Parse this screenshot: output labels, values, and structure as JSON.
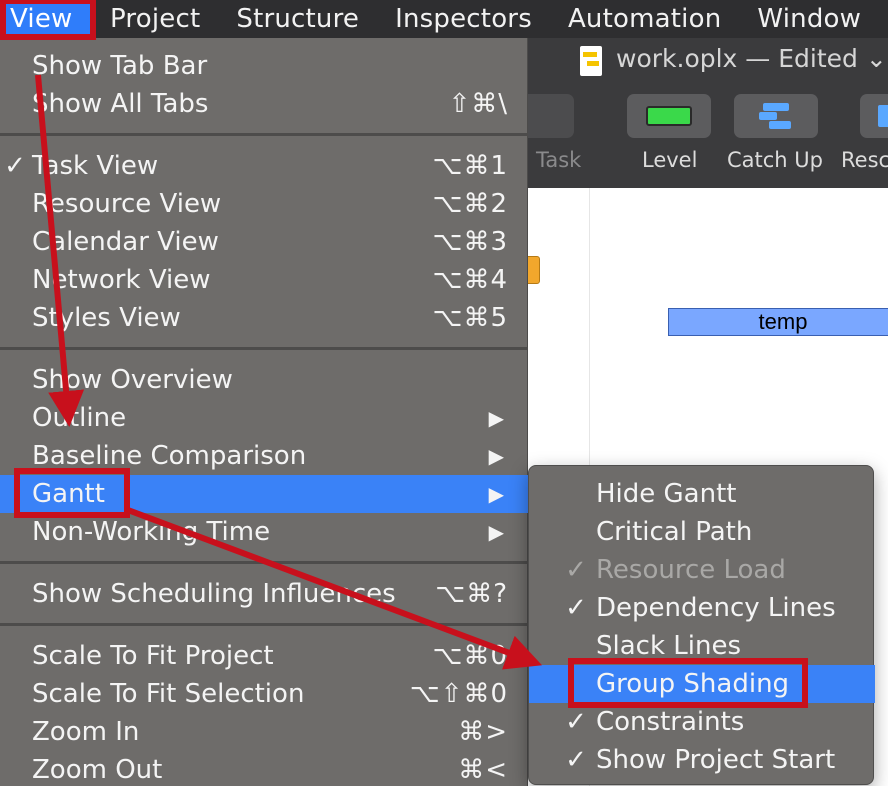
{
  "menubar": {
    "items": [
      "View",
      "Project",
      "Structure",
      "Inspectors",
      "Automation",
      "Window"
    ]
  },
  "window": {
    "document_title": "work.oplx — Edited ⌄",
    "toolbar": {
      "task_label": "Task",
      "level_label": "Level",
      "catch_up_label": "Catch Up",
      "resc_label": "Resc"
    },
    "gantt": {
      "bar_label": "temp"
    }
  },
  "view_menu": {
    "show_tab_bar": "Show Tab Bar",
    "show_all_tabs": "Show All Tabs",
    "show_all_tabs_sc": "⇧⌘\\",
    "task_view": "Task View",
    "task_view_sc": "⌥⌘1",
    "resource_view": "Resource View",
    "resource_view_sc": "⌥⌘2",
    "calendar_view": "Calendar View",
    "calendar_view_sc": "⌥⌘3",
    "network_view": "Network View",
    "network_view_sc": "⌥⌘4",
    "styles_view": "Styles View",
    "styles_view_sc": "⌥⌘5",
    "show_overview": "Show Overview",
    "outline": "Outline",
    "baseline_comparison": "Baseline Comparison",
    "gantt": "Gantt",
    "non_working_time": "Non-Working Time",
    "show_scheduling_influences": "Show Scheduling Influences",
    "show_scheduling_influences_sc": "⌥⌘?",
    "scale_to_fit_project": "Scale To Fit Project",
    "scale_to_fit_project_sc": "⌥⌘0",
    "scale_to_fit_selection": "Scale To Fit Selection",
    "scale_to_fit_selection_sc": "⌥⇧⌘0",
    "zoom_in": "Zoom In",
    "zoom_in_sc": "⌘>",
    "zoom_out": "Zoom Out",
    "zoom_out_sc": "⌘<",
    "checkmark": "✓",
    "submenu_arrow": "▶"
  },
  "gantt_submenu": {
    "hide_gantt": "Hide Gantt",
    "critical_path": "Critical Path",
    "resource_load": "Resource Load",
    "dependency_lines": "Dependency Lines",
    "slack_lines": "Slack Lines",
    "group_shading": "Group Shading",
    "constraints": "Constraints",
    "show_project_start": "Show Project Start",
    "checkmark": "✓"
  },
  "colors": {
    "highlight": "#3a82f7",
    "menu_bg": "#6e6c6a",
    "annotation_red": "#c8101c"
  }
}
